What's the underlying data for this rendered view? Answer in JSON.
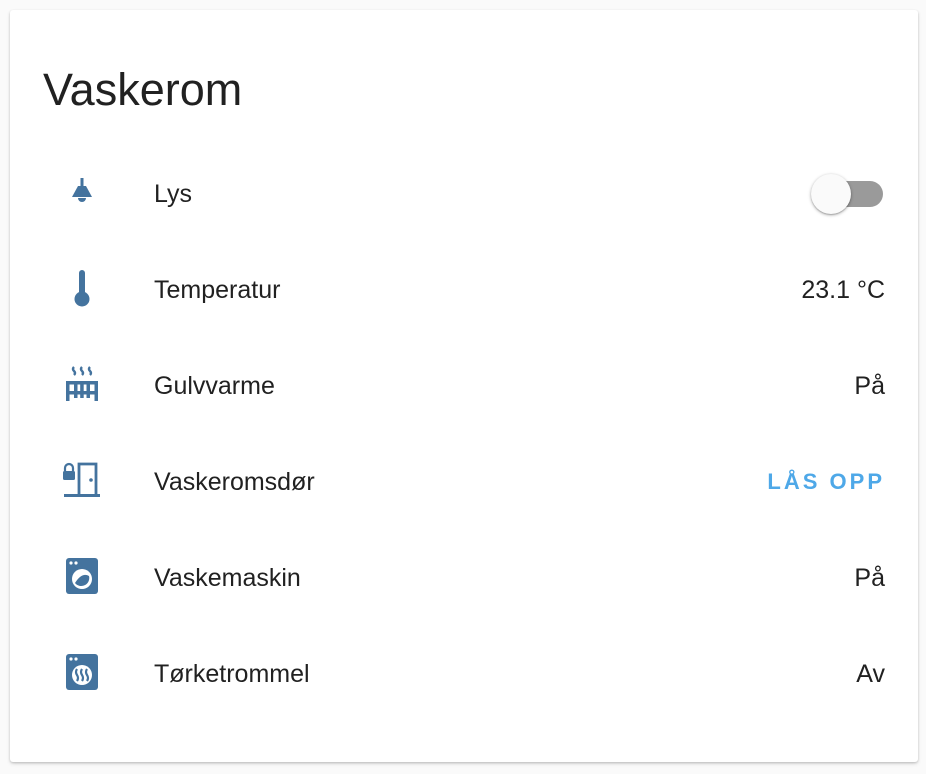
{
  "card": {
    "title": "Vaskerom",
    "icon_color": "#44739e",
    "accent_color": "#4ea8e8",
    "rows": [
      {
        "label": "Lys",
        "icon": "ceiling-light-icon",
        "control": "toggle",
        "toggle_on": false
      },
      {
        "label": "Temperatur",
        "icon": "thermometer-icon",
        "state": "23.1 °C"
      },
      {
        "label": "Gulvvarme",
        "icon": "radiator-icon",
        "state": "På"
      },
      {
        "label": "Vaskeromsdør",
        "icon": "door-lock-icon",
        "action": "LÅS OPP"
      },
      {
        "label": "Vaskemaskin",
        "icon": "washing-machine-icon",
        "state": "På"
      },
      {
        "label": "Tørketrommel",
        "icon": "tumble-dryer-icon",
        "state": "Av"
      }
    ]
  }
}
